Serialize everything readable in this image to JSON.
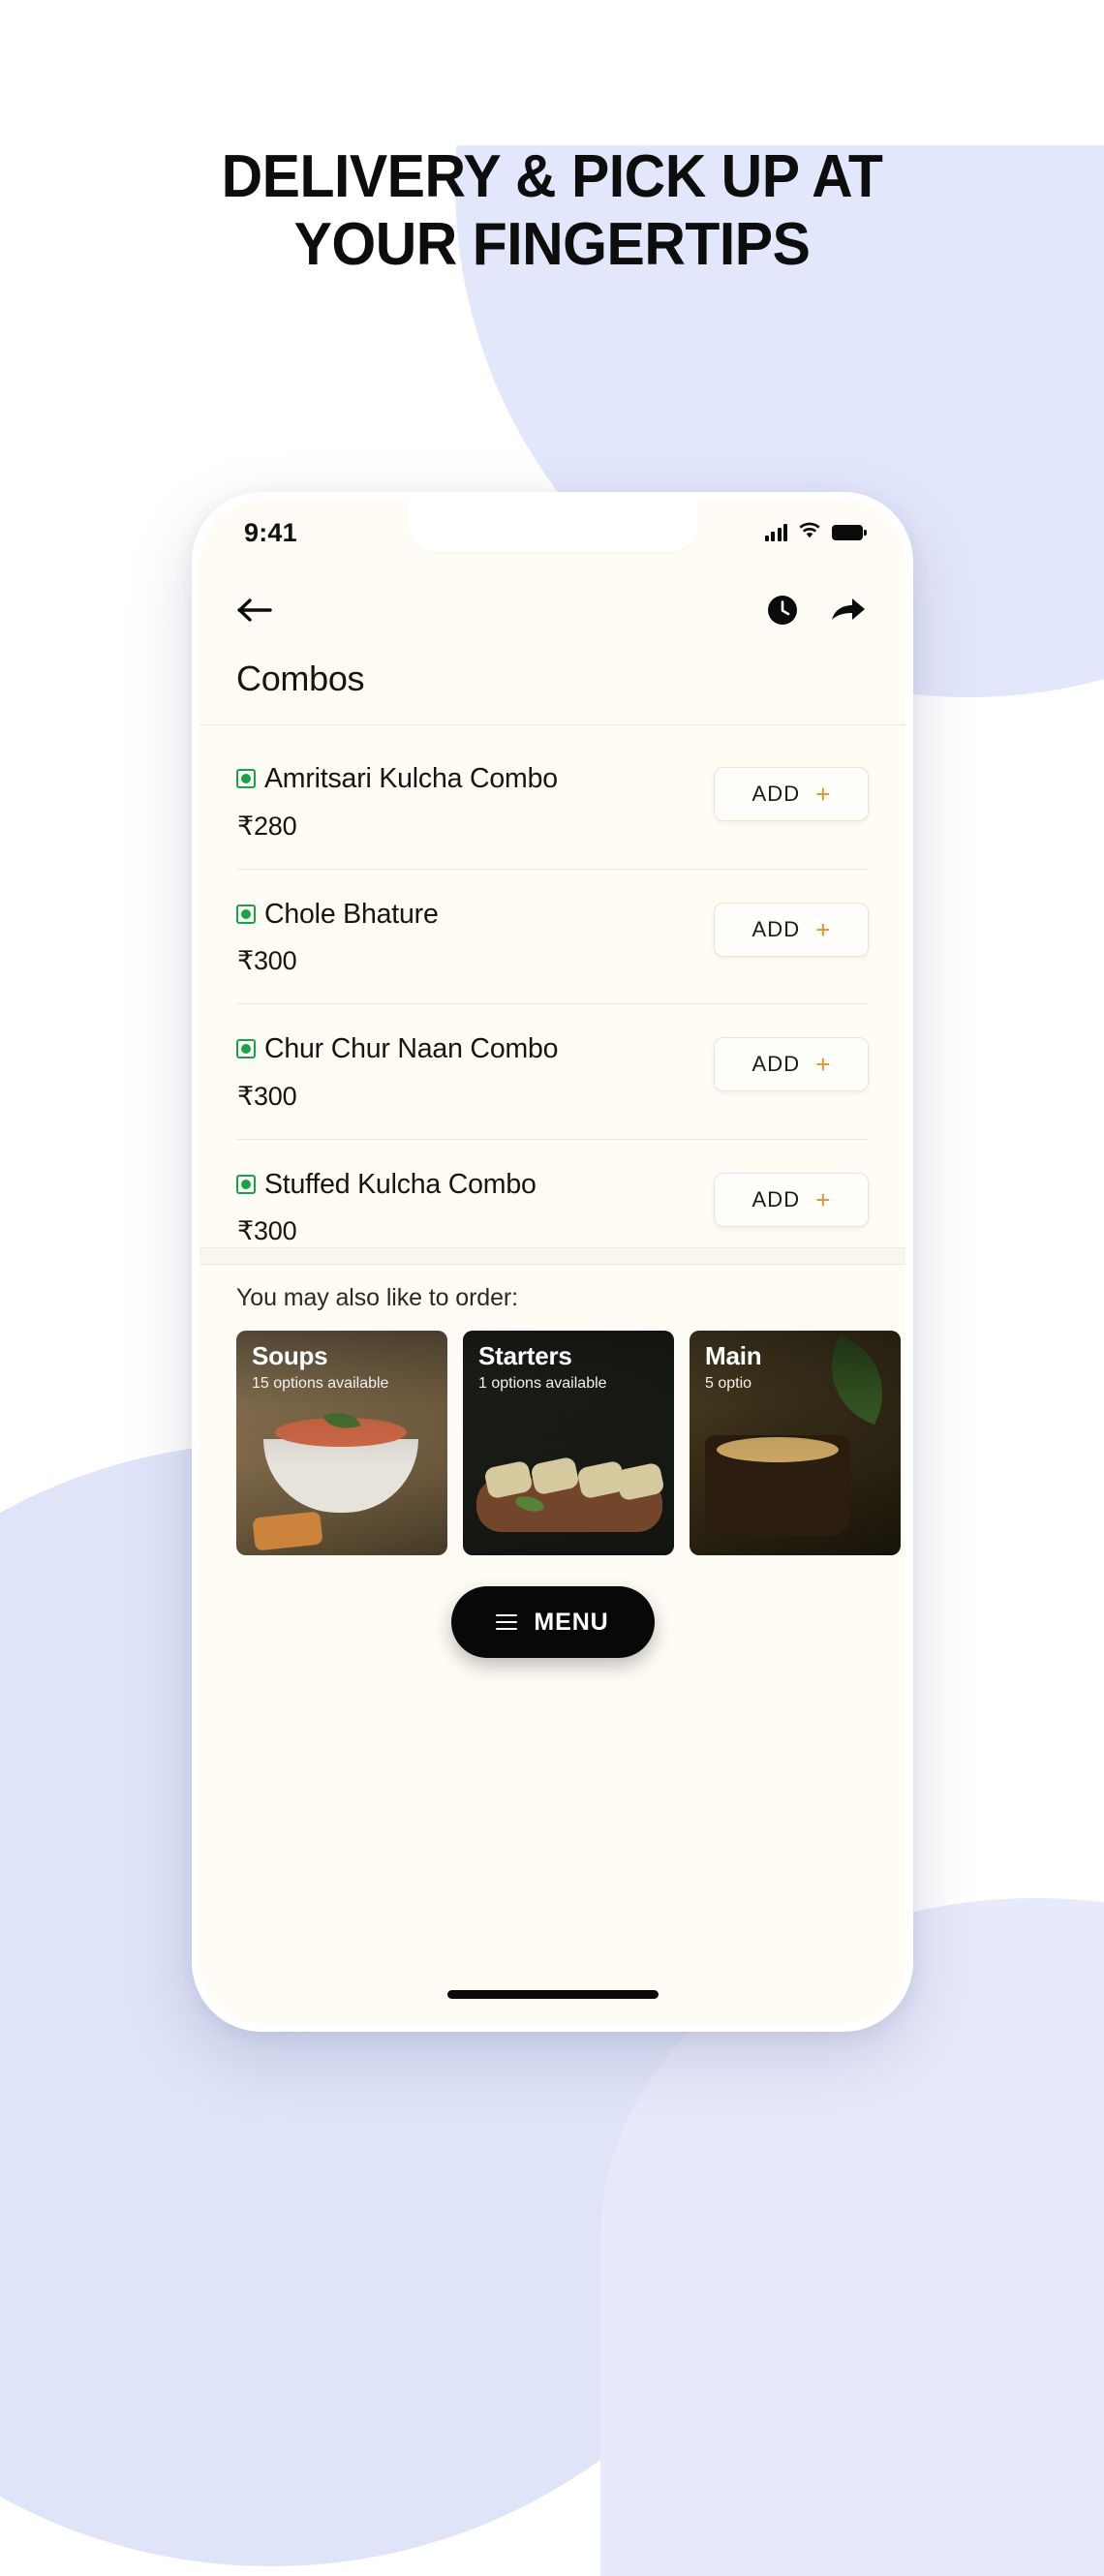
{
  "marketing": {
    "headline_line1": "DELIVERY & PICK UP AT",
    "headline_line2": "YOUR FINGERTIPS",
    "accent_color": "#e3e7fb",
    "text_color": "#0d0d0d"
  },
  "phone": {
    "status_bar": {
      "time": "9:41",
      "signal_icon": "cellular-signal-icon",
      "wifi_icon": "wifi-icon",
      "battery_icon": "battery-full-icon"
    },
    "nav": {
      "back_icon": "back-arrow-icon",
      "history_icon": "clock-icon",
      "share_icon": "share-arrow-icon"
    },
    "screen_background": "#fffcf5",
    "section": {
      "title": "Combos"
    },
    "menu_items": [
      {
        "name": "Amritsari Kulcha Combo",
        "price": "₹280",
        "diet": "veg",
        "add_label": "ADD",
        "add_plus": "+"
      },
      {
        "name": "Chole Bhature",
        "price": "₹300",
        "diet": "veg",
        "add_label": "ADD",
        "add_plus": "+"
      },
      {
        "name": "Chur Chur Naan Combo",
        "price": "₹300",
        "diet": "veg",
        "add_label": "ADD",
        "add_plus": "+"
      },
      {
        "name": "Stuffed Kulcha Combo",
        "price": "₹300",
        "diet": "veg",
        "add_label": "ADD",
        "add_plus": "+"
      }
    ],
    "suggestions": {
      "title": "You may also like to order:",
      "cards": [
        {
          "name": "Soups",
          "subtitle": "15 options available"
        },
        {
          "name": "Starters",
          "subtitle": "1 options available"
        },
        {
          "name": "Main",
          "subtitle": "5 optio"
        }
      ]
    },
    "fab": {
      "label": "MENU",
      "icon": "hamburger-menu-icon"
    },
    "add_button_plus_color": "#e8902e",
    "veg_indicator_color": "#17a34a"
  }
}
